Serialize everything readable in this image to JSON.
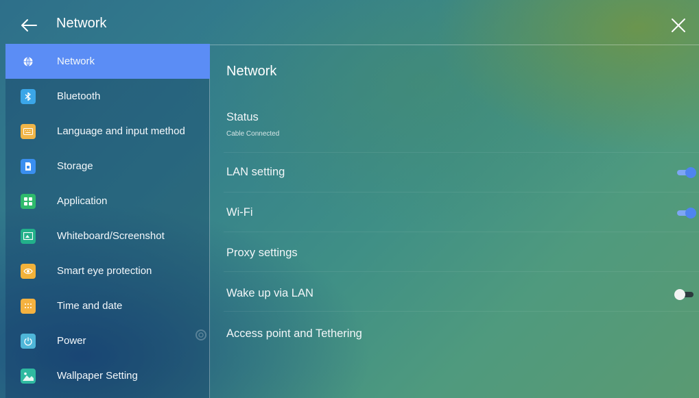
{
  "header": {
    "title": "Network",
    "back_icon": "arrow-left-icon",
    "close_icon": "close-icon"
  },
  "sidebar": {
    "items": [
      {
        "label": "Network",
        "icon": "globe-icon",
        "color": "#5b8df5",
        "active": true
      },
      {
        "label": "Bluetooth",
        "icon": "bluetooth-icon",
        "color": "#3ba6e8"
      },
      {
        "label": "Language and input method",
        "icon": "keyboard-icon",
        "color": "#f0b548"
      },
      {
        "label": "Storage",
        "icon": "storage-icon",
        "color": "#3a8ff0"
      },
      {
        "label": "Application",
        "icon": "apps-grid-icon",
        "color": "#2fba6c"
      },
      {
        "label": "Whiteboard/Screenshot",
        "icon": "screenshot-icon",
        "color": "#22b08a"
      },
      {
        "label": "Smart eye protection",
        "icon": "eye-icon",
        "color": "#f2b23a"
      },
      {
        "label": "Time and date",
        "icon": "calendar-icon",
        "color": "#f4b240"
      },
      {
        "label": "Power",
        "icon": "power-icon",
        "color": "#4fb6d8"
      },
      {
        "label": "Wallpaper Setting",
        "icon": "image-icon",
        "color": "#2fb9a0"
      }
    ]
  },
  "main": {
    "section_title": "Network",
    "rows": [
      {
        "label": "Status",
        "sublabel": "Cable Connected"
      },
      {
        "label": "LAN setting",
        "toggle": "on"
      },
      {
        "label": "Wi-Fi",
        "toggle": "on"
      },
      {
        "label": "Proxy settings"
      },
      {
        "label": "Wake up via LAN",
        "toggle": "off"
      },
      {
        "label": "Access point and Tethering"
      }
    ]
  },
  "colors": {
    "accent": "#5b8df5",
    "toggle_on": "#4f84f0"
  }
}
